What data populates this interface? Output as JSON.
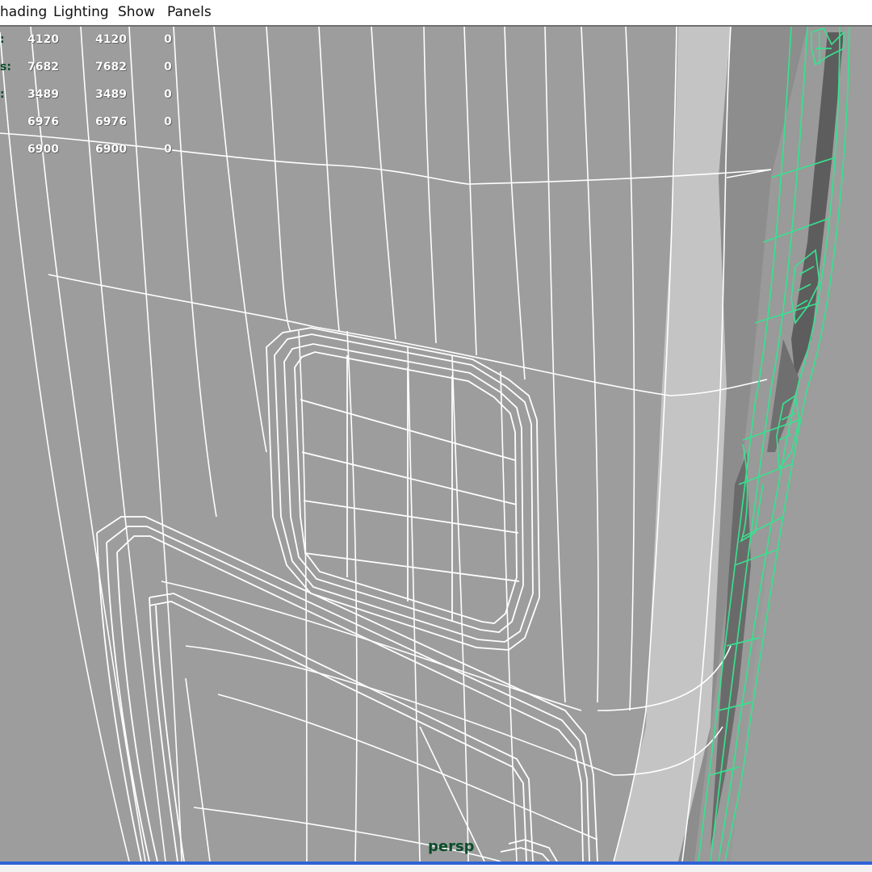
{
  "menu": {
    "items": [
      {
        "label": "hading"
      },
      {
        "label": "Lighting"
      },
      {
        "label": "Show"
      },
      {
        "label": "Panels"
      }
    ]
  },
  "hud": {
    "rows": [
      {
        "label": ":",
        "c1": "4120",
        "c2": "4120",
        "c3": "0"
      },
      {
        "label": "s:",
        "c1": "7682",
        "c2": "7682",
        "c3": "0"
      },
      {
        "label": ":",
        "c1": "3489",
        "c2": "3489",
        "c3": "0"
      },
      {
        "label": "",
        "c1": "6976",
        "c2": "6976",
        "c3": "0"
      },
      {
        "label": "",
        "c1": "6900",
        "c2": "6900",
        "c3": "0"
      }
    ]
  },
  "viewport": {
    "camera": "persp"
  },
  "colors": {
    "wire": "#ffffff",
    "selected_wire": "#39e08f",
    "surface": "#9d9d9d",
    "highlight_band": "#c6c6c6",
    "shadow_strip": "#5d5d5d",
    "hud_label": "#0b4d2a",
    "status_accent": "#2f62d8"
  }
}
